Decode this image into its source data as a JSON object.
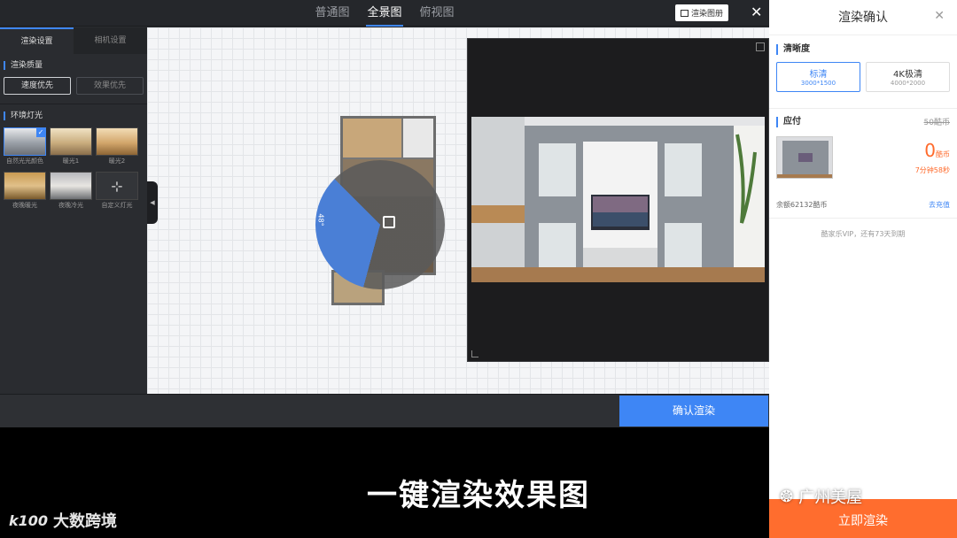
{
  "view_tabs": [
    "普通图",
    "全景图",
    "俯视图"
  ],
  "active_view_tab": 1,
  "album_button": "渲染图册",
  "close_symbol": "✕",
  "panel_tabs": [
    "渲染设置",
    "相机设置"
  ],
  "quality": {
    "title": "渲染质量",
    "options": [
      "速度优先",
      "效果优先"
    ],
    "selected": 0
  },
  "lighting": {
    "title": "环境灯光",
    "items": [
      {
        "label": "自然光光颜色",
        "selected": true
      },
      {
        "label": "暖光1"
      },
      {
        "label": "暖光2"
      },
      {
        "label": "夜晚暖光"
      },
      {
        "label": "夜晚冷光"
      },
      {
        "label": "自定义灯光"
      }
    ]
  },
  "canvas": {
    "cone_label": "48°"
  },
  "confirm_render_label": "确认渲染",
  "caption": "一键渲染效果图",
  "brand_left": {
    "logo": "k100",
    "text": "大数跨境"
  },
  "brand_right": "广州美屋",
  "right_panel": {
    "title": "渲染确认",
    "clarity_title": "清晰度",
    "resolutions": [
      {
        "name": "标清",
        "size": "3000*1500",
        "selected": true
      },
      {
        "name": "4K极清",
        "size": "4000*2000",
        "selected": false
      }
    ],
    "payable_title": "应付",
    "original_price": "50酷币",
    "price": "0",
    "price_unit": "酷币",
    "eta": "7分钟58秒",
    "balance": "余额62132酷币",
    "recharge": "去充值",
    "vip_note": "酷家乐VIP，还有73天到期",
    "render_now": "立即渲染"
  },
  "colors": {
    "accent": "#3e86f5",
    "orange": "#ff6d2e"
  }
}
